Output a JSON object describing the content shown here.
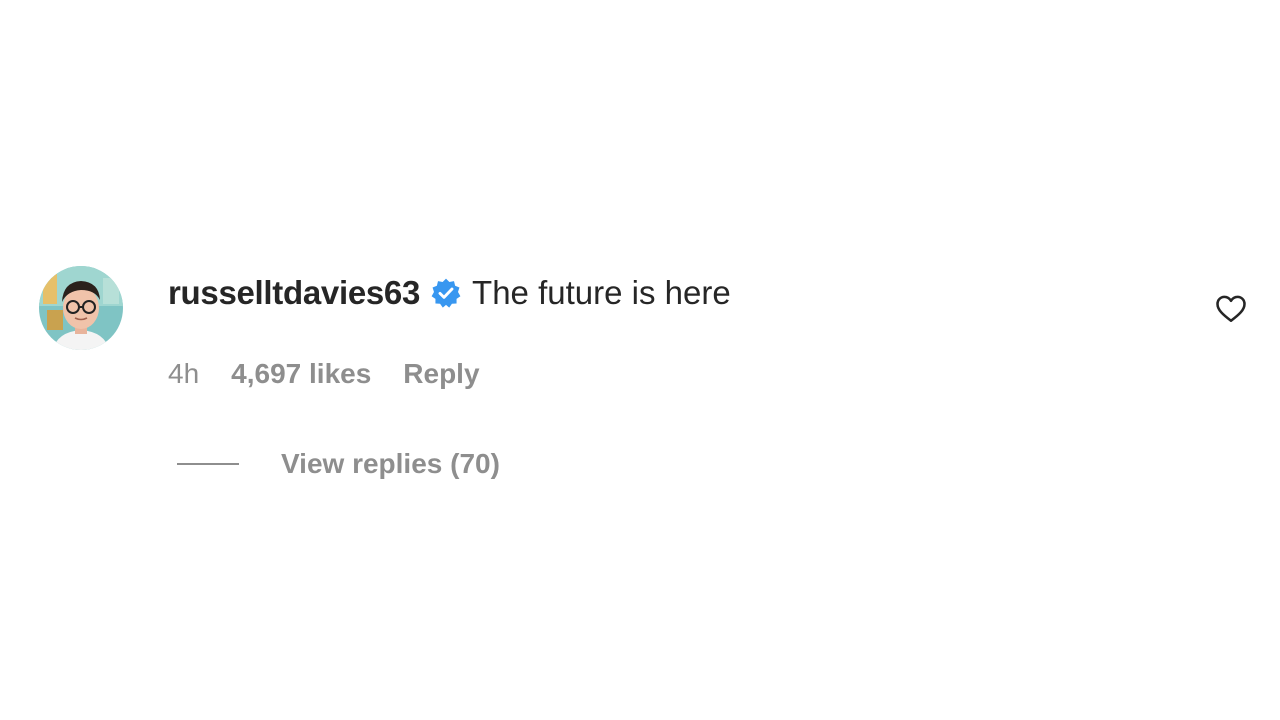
{
  "comment": {
    "username": "russelltdavies63",
    "verified": true,
    "verified_badge_icon": "verified-badge-icon",
    "text": "The future is here",
    "time": "4h",
    "likes": "4,697 likes",
    "reply_label": "Reply",
    "view_replies_label": "View replies (70)",
    "like_icon": "heart-outline-icon",
    "avatar_icon": "profile-photo"
  },
  "colors": {
    "primary_text": "#262626",
    "secondary_text": "#8e8e8e",
    "verified_blue": "#3897f0",
    "background": "#ffffff"
  }
}
